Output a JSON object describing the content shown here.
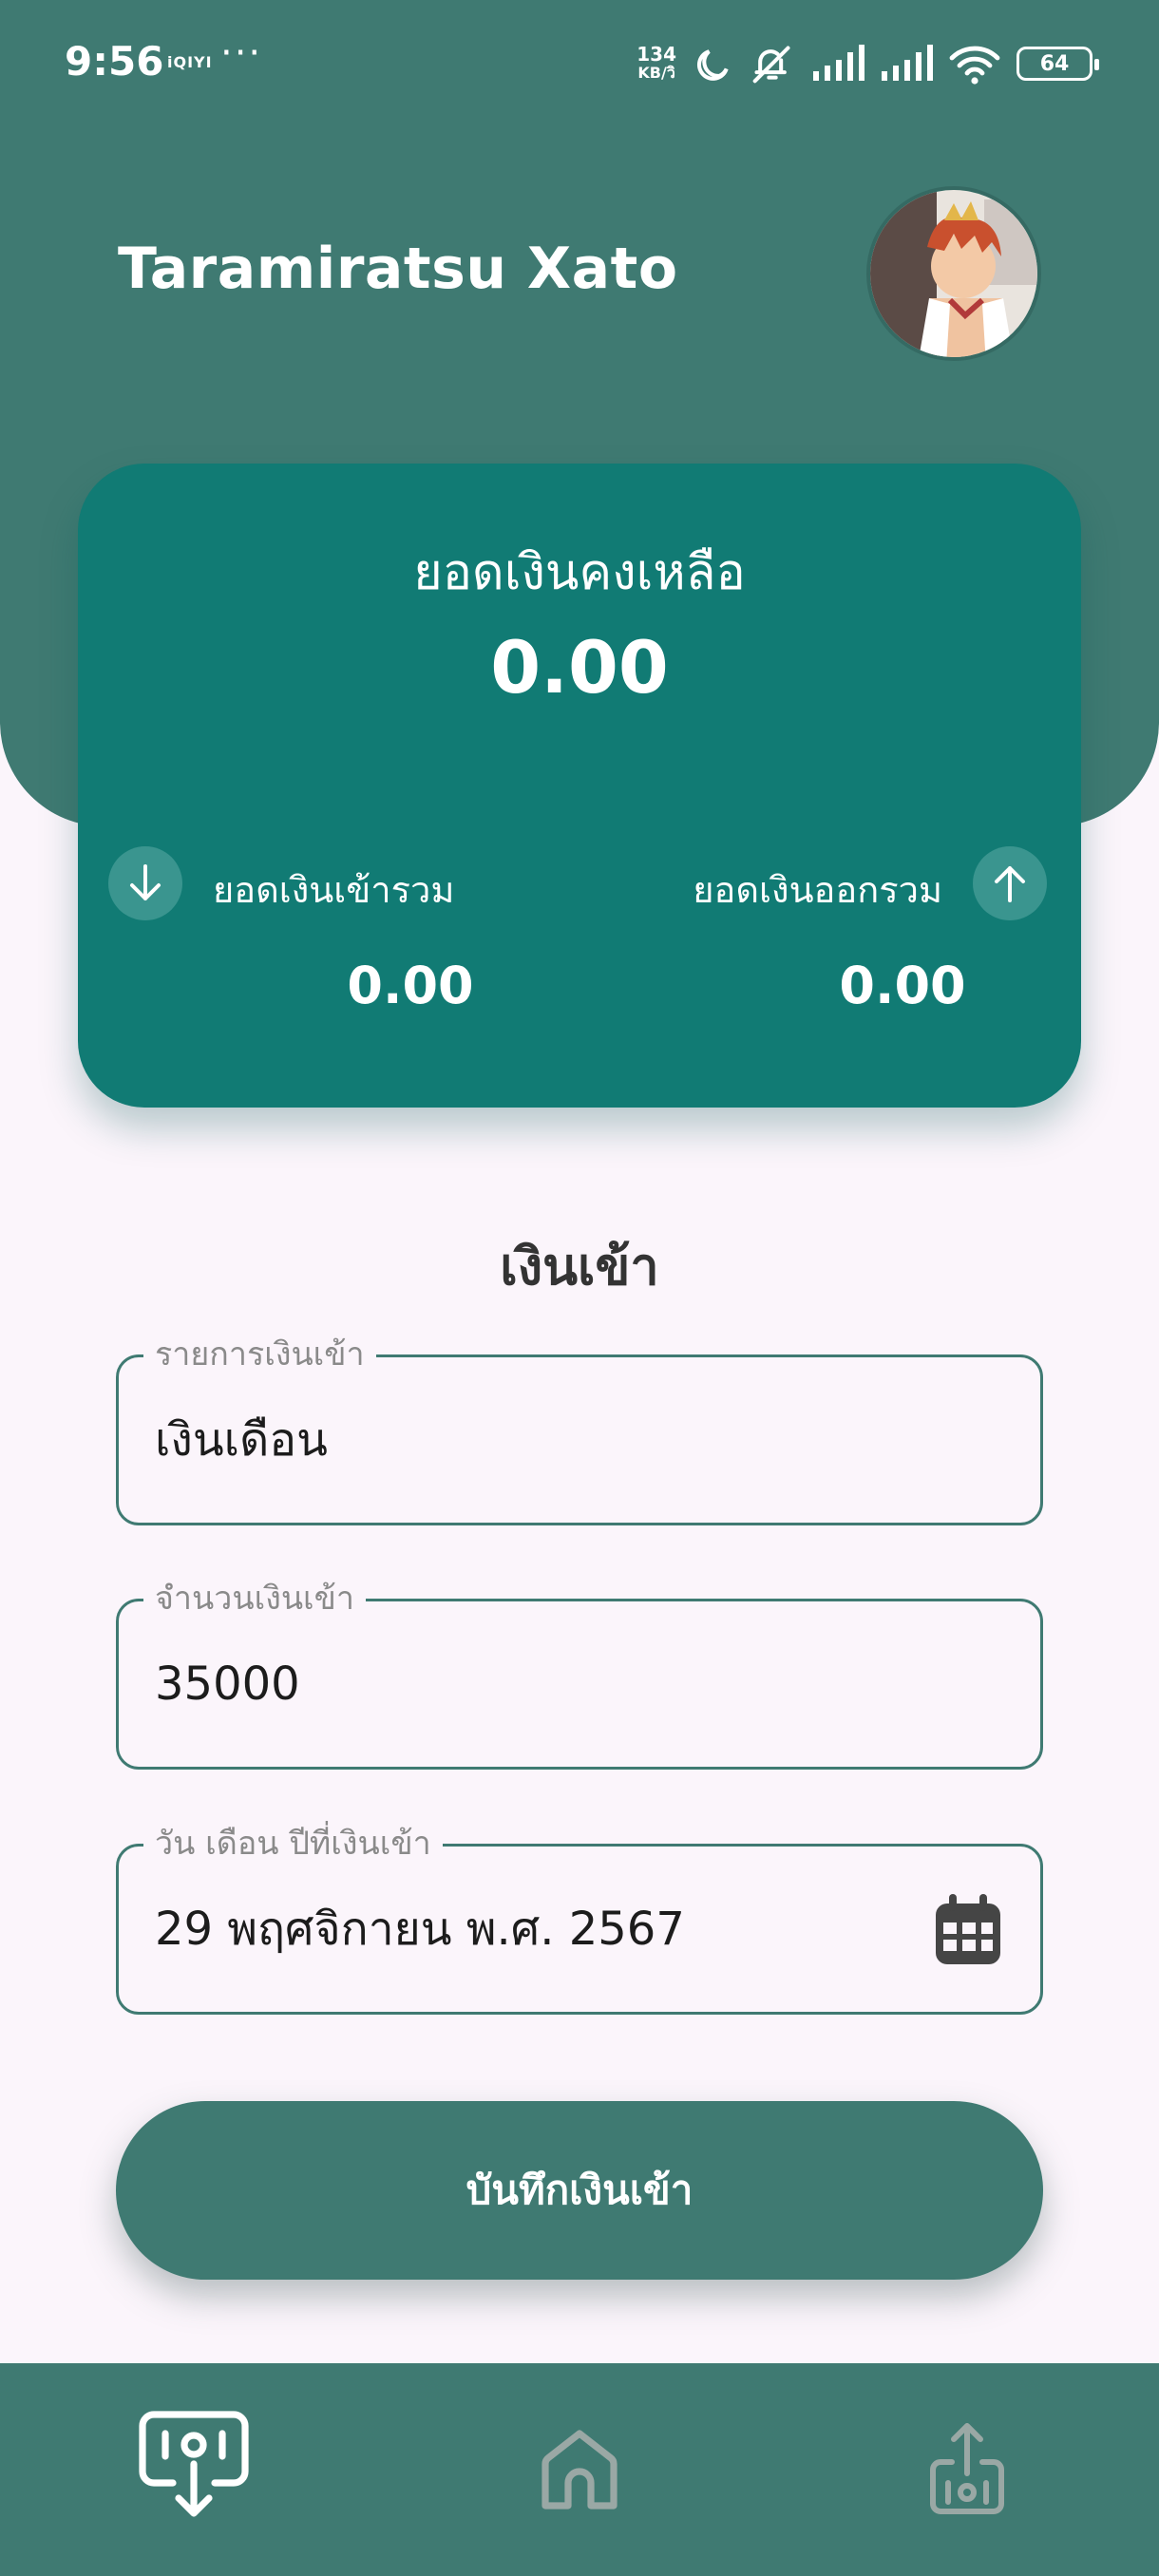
{
  "status_bar": {
    "time": "9:56",
    "app_badge": "iQIYI",
    "more": "···",
    "net_speed_value": "134",
    "net_speed_unit": "KB/วิ",
    "battery": "64"
  },
  "header": {
    "user_name": "Taramiratsu Xato",
    "avatar_icon": "user-avatar"
  },
  "balance_card": {
    "title": "ยอดเงินคงเหลือ",
    "amount": "0.00",
    "income_label": "ยอดเงินเข้ารวม",
    "income_value": "0.00",
    "expense_label": "ยอดเงินออกรวม",
    "expense_value": "0.00"
  },
  "form": {
    "title": "เงินเข้า",
    "item_label": "รายการเงินเข้า",
    "item_value": "เงินเดือน",
    "amount_label": "จำนวนเงินเข้า",
    "amount_value": "35000",
    "date_label": "วัน เดือน ปีที่เงินเข้า",
    "date_value": "29 พฤศจิกายน พ.ศ. 2567",
    "save_label": "บันทึกเงินเข้า"
  },
  "bottom_nav": {
    "items": [
      {
        "icon": "income-icon",
        "active": true
      },
      {
        "icon": "home-icon",
        "active": false
      },
      {
        "icon": "expense-icon",
        "active": false
      }
    ]
  },
  "colors": {
    "header": "#3f7a72",
    "card": "#117b74",
    "background": "#fbf5fb",
    "nav_active": "#ffffff",
    "nav_inactive": "#9aa8a5"
  }
}
